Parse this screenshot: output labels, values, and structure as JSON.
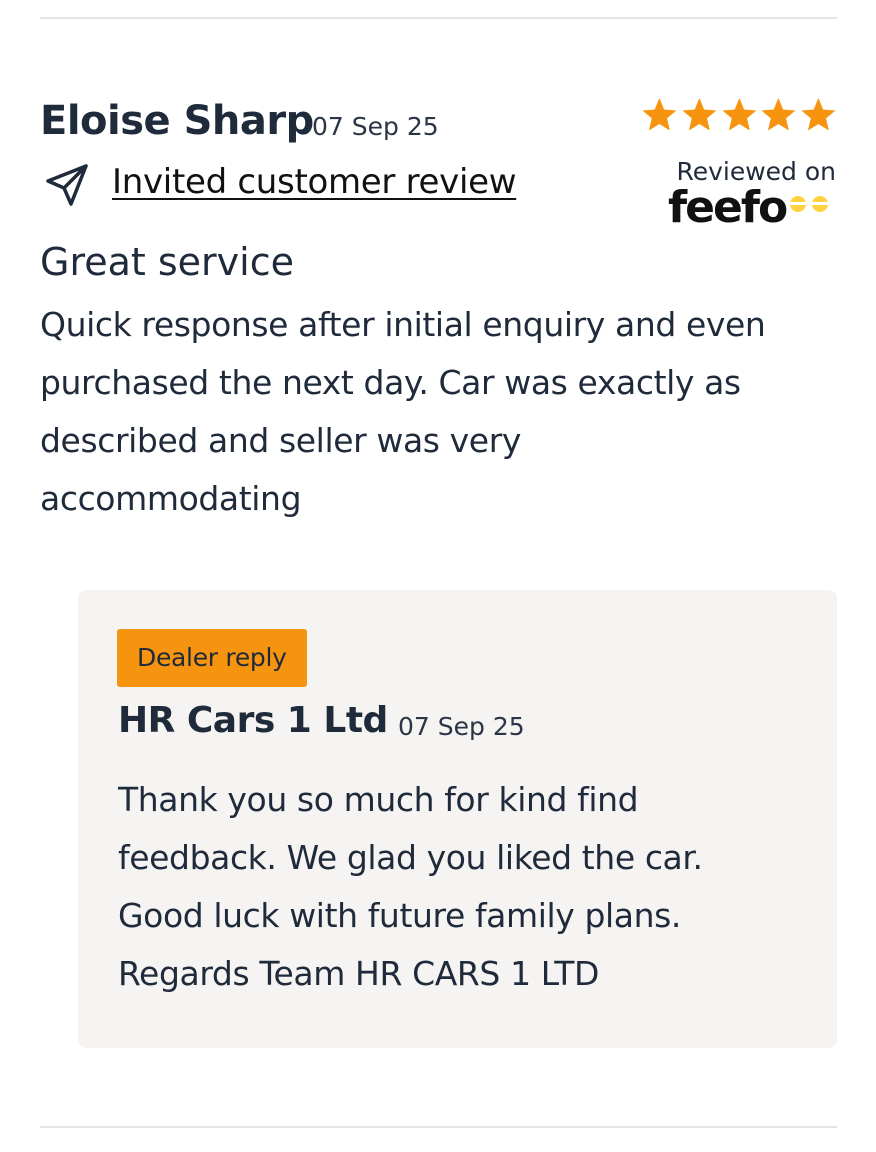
{
  "review": {
    "reviewer_name": "Eloise Sharp",
    "date": "07 Sep 25",
    "invited_label": "Invited customer review",
    "rating": 5,
    "rating_max": 5,
    "reviewed_on_label": "Reviewed on",
    "brand": "feefo",
    "title": "Great service",
    "body_lines": [
      "Quick response after initial enquiry and even",
      "purchased the next day. Car was exactly as",
      "described and seller was very",
      "accommodating"
    ]
  },
  "reply": {
    "badge_label": "Dealer reply",
    "dealer_name": "HR Cars 1 Ltd",
    "date": "07 Sep 25",
    "body_lines": [
      "Thank you so much for kind find",
      "feedback. We glad you liked the car.",
      "Good luck with future family plans.",
      "Regards Team HR CARS 1 LTD"
    ]
  },
  "colors": {
    "star": "#f7940f",
    "badge": "#f7940f",
    "text": "#1f2a3a",
    "reply_background": "#f5f4f2",
    "feefo_dots": "#ffd23f"
  },
  "icons": {
    "invited": "send-icon",
    "star": "star-icon"
  }
}
